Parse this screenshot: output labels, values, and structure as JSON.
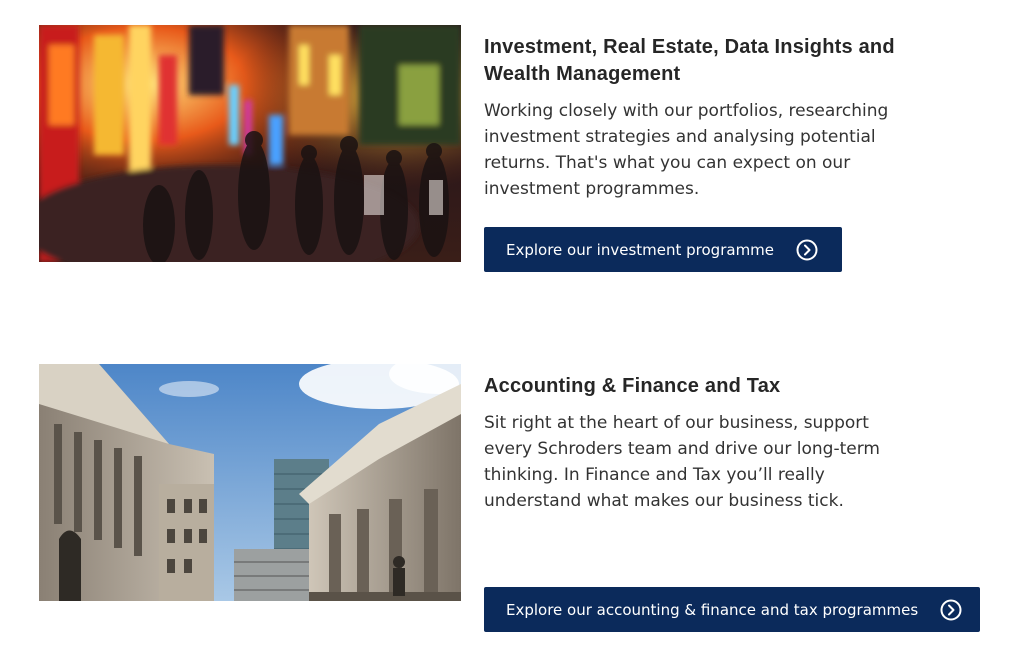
{
  "programmes": [
    {
      "title": "Investment, Real Estate, Data Insights and Wealth Management",
      "description": "Working closely with our portfolios, researching investment strategies and analysing potential returns. That's what you can expect on our investment programmes.",
      "button_label": "Explore our investment programme",
      "image": "busy-city-street-photo",
      "button_icon": "circle-chevron-right-icon"
    },
    {
      "title": "Accounting & Finance and Tax",
      "description": "Sit right at the heart of our business, support every Schroders team and drive our long-term thinking. In Finance and Tax you’ll really understand what makes our business tick.",
      "button_label": "Explore our accounting & finance and tax programmes",
      "image": "classical-bank-buildings-photo",
      "button_icon": "circle-chevron-right-icon"
    }
  ],
  "colors": {
    "button_bg": "#0b2a5b",
    "button_text": "#ffffff",
    "title_text": "#262626",
    "body_text": "#333333"
  }
}
